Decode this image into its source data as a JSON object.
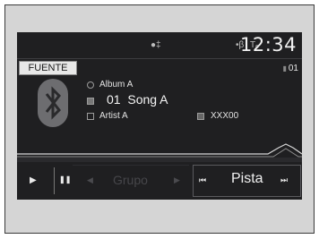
{
  "status": {
    "icons": [
      "bluetooth-phone-icon",
      "bluetooth-icon",
      "signal-icon"
    ],
    "clock": "12:34"
  },
  "source": {
    "label": "FUENTE",
    "preset": "01"
  },
  "track": {
    "album": "Album A",
    "track_number": "01",
    "song": "Song A",
    "artist": "Artist A",
    "file": "XXX00"
  },
  "controls": {
    "group_label": "Grupo",
    "track_label": "Pista"
  }
}
